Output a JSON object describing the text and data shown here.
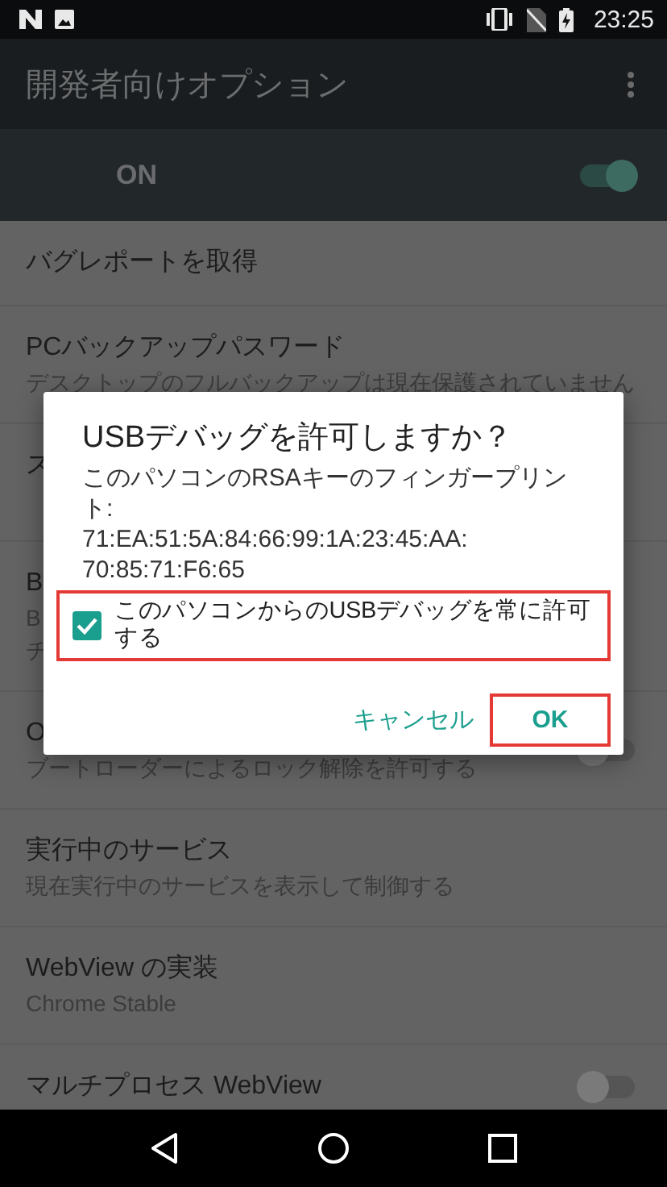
{
  "status_bar": {
    "time": "23:25"
  },
  "toolbar": {
    "title": "開発者向けオプション"
  },
  "master_switch": {
    "label": "ON",
    "on": true
  },
  "settings": [
    {
      "title": "バグレポートを取得"
    },
    {
      "title": "PCバックアップパスワード",
      "subtitle": "デスクトップのフルバックアップは現在保護されていません"
    },
    {
      "title": "ス"
    },
    {
      "title": "B",
      "subtitle": "B",
      "subtitle_2": "チ"
    },
    {
      "title": "O",
      "subtitle": "ブートローダーによるロック解除を許可する",
      "toggle": {
        "on": false
      }
    },
    {
      "title": "実行中のサービス",
      "subtitle": "現在実行中のサービスを表示して制御する"
    },
    {
      "title": "WebView の実装",
      "subtitle": "Chrome Stable"
    },
    {
      "title": "マルチプロセス WebView",
      "toggle": {
        "on": false
      }
    }
  ],
  "dialog": {
    "title": "USBデバッグを許可しますか？",
    "message": "このパソコンのRSAキーのフィンガープリント:",
    "fingerprint": "71:EA:51:5A:84:66:99:1A:23:45:AA: 70:85:71:F6:65",
    "checkbox": {
      "label": "このパソコンからのUSBデバッグを常に許可する",
      "checked": true
    },
    "buttons": [
      "キャンセル",
      "OK"
    ]
  }
}
